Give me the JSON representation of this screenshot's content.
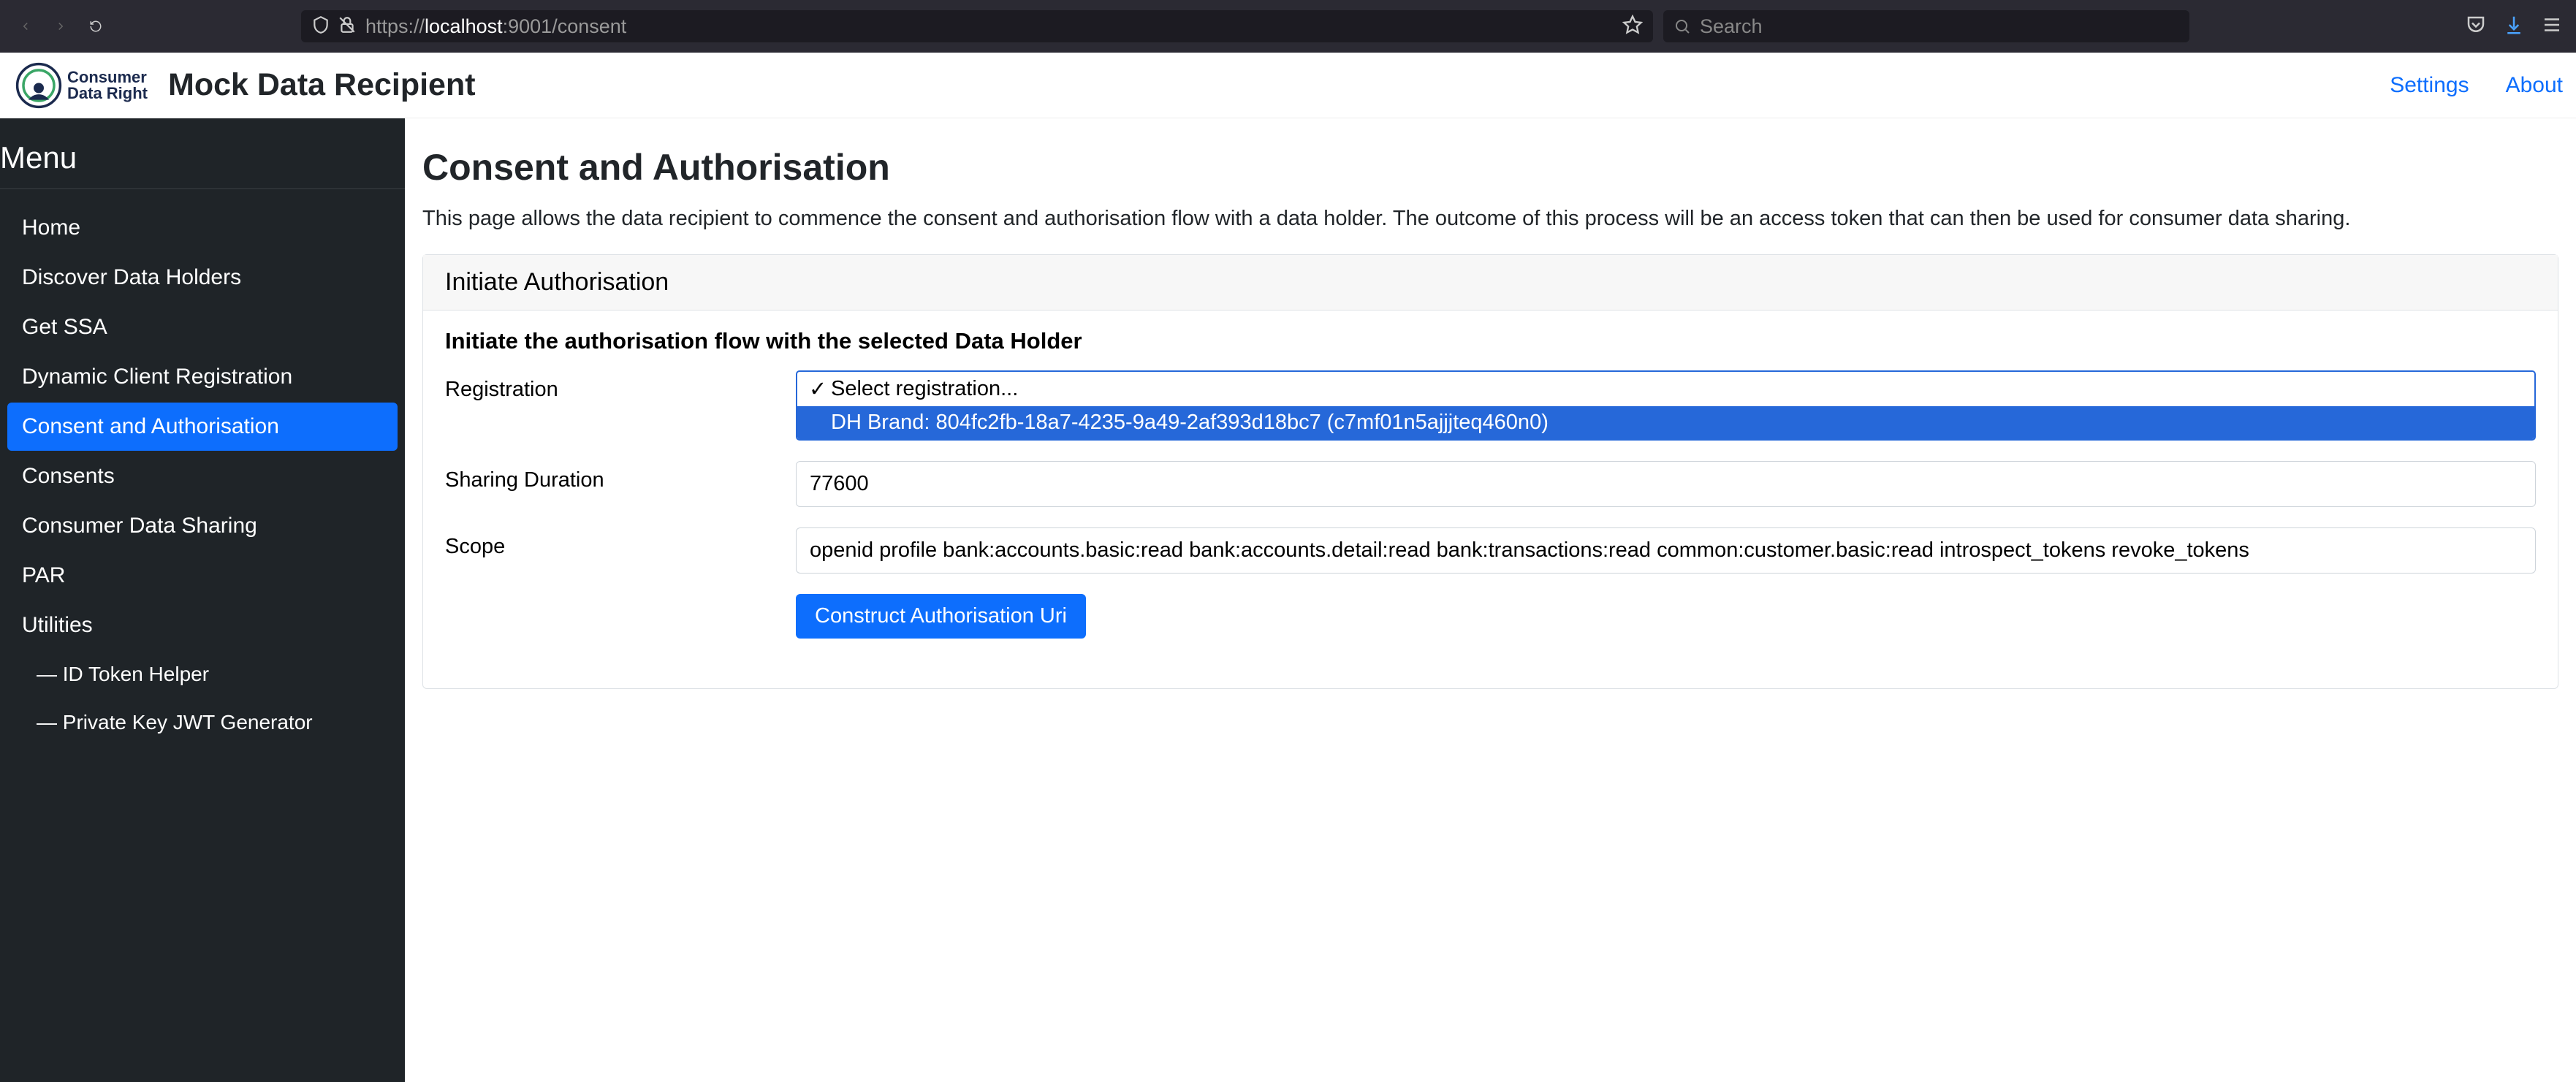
{
  "browser": {
    "url_prefix": "https://",
    "url_host": "localhost",
    "url_suffix": ":9001/consent",
    "search_placeholder": "Search"
  },
  "header": {
    "logo_line1": "Consumer",
    "logo_line2": "Data Right",
    "app_title": "Mock Data Recipient",
    "link_settings": "Settings",
    "link_about": "About"
  },
  "sidebar": {
    "heading": "Menu",
    "items": [
      {
        "label": "Home"
      },
      {
        "label": "Discover Data Holders"
      },
      {
        "label": "Get SSA"
      },
      {
        "label": "Dynamic Client Registration"
      },
      {
        "label": "Consent and Authorisation"
      },
      {
        "label": "Consents"
      },
      {
        "label": "Consumer Data Sharing"
      },
      {
        "label": "PAR"
      },
      {
        "label": "Utilities"
      }
    ],
    "subitems": [
      {
        "label": "— ID Token Helper"
      },
      {
        "label": "— Private Key JWT Generator"
      }
    ]
  },
  "page": {
    "title": "Consent and Authorisation",
    "description": "This page allows the data recipient to commence the consent and authorisation flow with a data holder. The outcome of this process will be an access token that can then be used for consumer data sharing."
  },
  "card": {
    "header": "Initiate Authorisation",
    "subtitle": "Initiate the authorisation flow with the selected Data Holder",
    "registration_label": "Registration",
    "registration_placeholder": "Select registration...",
    "registration_option": "DH Brand: 804fc2fb-18a7-4235-9a49-2af393d18bc7 (c7mf01n5ajjjteq460n0)",
    "sharing_label": "Sharing Duration",
    "sharing_value": "77600",
    "scope_label": "Scope",
    "scope_value": "openid profile bank:accounts.basic:read bank:accounts.detail:read bank:transactions:read common:customer.basic:read introspect_tokens revoke_tokens",
    "button_label": "Construct Authorisation Uri"
  }
}
